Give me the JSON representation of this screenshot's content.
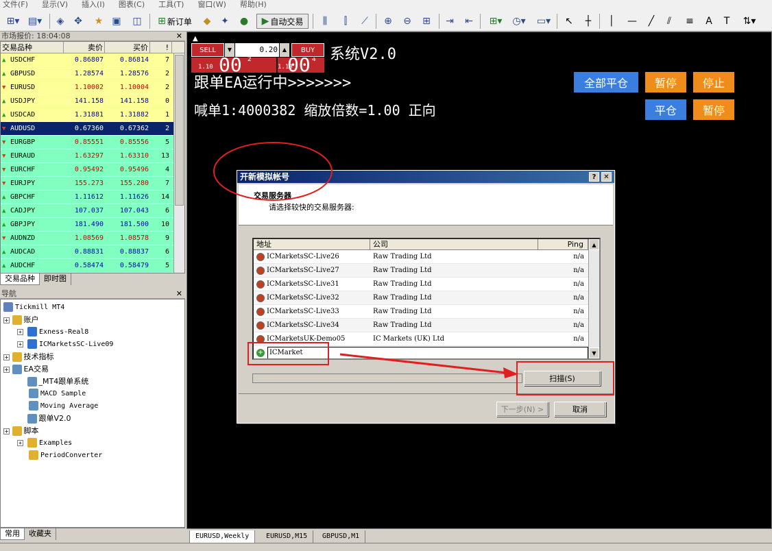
{
  "menu": [
    "文件(F)",
    "显示(V)",
    "插入(I)",
    "图表(C)",
    "工具(T)",
    "窗口(W)",
    "帮助(H)"
  ],
  "toolbar": {
    "new_order": "新订单",
    "auto_trade": "自动交易"
  },
  "market_watch": {
    "title": "市场报价: 18:04:08",
    "headers": [
      "交易品种",
      "卖价",
      "买价",
      "!"
    ],
    "rows": [
      {
        "symbol": "USDCHF",
        "bid": "0.86807",
        "ask": "0.86814",
        "spread": "7",
        "dir": "up",
        "bg": "#ffff99"
      },
      {
        "symbol": "GBPUSD",
        "bid": "1.28574",
        "ask": "1.28576",
        "spread": "2",
        "dir": "up",
        "bg": "#ffff99"
      },
      {
        "symbol": "EURUSD",
        "bid": "1.10002",
        "ask": "1.10004",
        "spread": "2",
        "dir": "down",
        "bg": "#ffff99"
      },
      {
        "symbol": "USDJPY",
        "bid": "141.158",
        "ask": "141.158",
        "spread": "0",
        "dir": "up",
        "bg": "#ffff99"
      },
      {
        "symbol": "USDCAD",
        "bid": "1.31881",
        "ask": "1.31882",
        "spread": "1",
        "dir": "up",
        "bg": "#ffff99"
      },
      {
        "symbol": "AUDUSD",
        "bid": "0.67360",
        "ask": "0.67362",
        "spread": "2",
        "dir": "down",
        "bg": "#0a246a"
      },
      {
        "symbol": "EURGBP",
        "bid": "0.85551",
        "ask": "0.85556",
        "spread": "5",
        "dir": "down",
        "bg": "#80ffc0"
      },
      {
        "symbol": "EURAUD",
        "bid": "1.63297",
        "ask": "1.63310",
        "spread": "13",
        "dir": "down",
        "bg": "#80ffc0"
      },
      {
        "symbol": "EURCHF",
        "bid": "0.95492",
        "ask": "0.95496",
        "spread": "4",
        "dir": "down",
        "bg": "#80ffc0"
      },
      {
        "symbol": "EURJPY",
        "bid": "155.273",
        "ask": "155.280",
        "spread": "7",
        "dir": "down",
        "bg": "#80ffc0"
      },
      {
        "symbol": "GBPCHF",
        "bid": "1.11612",
        "ask": "1.11626",
        "spread": "14",
        "dir": "up",
        "bg": "#80ffc0"
      },
      {
        "symbol": "CADJPY",
        "bid": "107.037",
        "ask": "107.043",
        "spread": "6",
        "dir": "up",
        "bg": "#80ffc0"
      },
      {
        "symbol": "GBPJPY",
        "bid": "181.490",
        "ask": "181.500",
        "spread": "10",
        "dir": "up",
        "bg": "#80ffc0"
      },
      {
        "symbol": "AUDNZD",
        "bid": "1.08569",
        "ask": "1.08578",
        "spread": "9",
        "dir": "down",
        "bg": "#80ffc0"
      },
      {
        "symbol": "AUDCAD",
        "bid": "0.88831",
        "ask": "0.88837",
        "spread": "6",
        "dir": "up",
        "bg": "#80ffc0"
      },
      {
        "symbol": "AUDCHF",
        "bid": "0.58474",
        "ask": "0.58479",
        "spread": "5",
        "dir": "up",
        "bg": "#80ffc0"
      }
    ],
    "tabs": [
      "交易品种",
      "即时图"
    ]
  },
  "navigator": {
    "title": "导航",
    "items": [
      {
        "label": "Tickmill MT4",
        "level": 0,
        "cn": false,
        "plus": false,
        "icon": "#6080c0"
      },
      {
        "label": "账户",
        "level": 0,
        "cn": true,
        "plus": true,
        "icon": "#e0b030"
      },
      {
        "label": "Exness-Real8",
        "level": 1,
        "cn": false,
        "plus": true,
        "icon": "#3070d0"
      },
      {
        "label": "ICMarketsSC-Live09",
        "level": 1,
        "cn": false,
        "plus": true,
        "icon": "#3070d0"
      },
      {
        "label": "技术指标",
        "level": 0,
        "cn": true,
        "plus": true,
        "icon": "#e0b030"
      },
      {
        "label": "EA交易",
        "level": 0,
        "cn": true,
        "plus": true,
        "icon": "#6090c0"
      },
      {
        "label": "_MT4跟单系统",
        "level": 1,
        "cn": true,
        "plus": false,
        "icon": "#6090c0"
      },
      {
        "label": "MACD Sample",
        "level": 1,
        "cn": false,
        "plus": false,
        "icon": "#6090c0"
      },
      {
        "label": "Moving Average",
        "level": 1,
        "cn": false,
        "plus": false,
        "icon": "#6090c0"
      },
      {
        "label": "跟单V2.0",
        "level": 1,
        "cn": true,
        "plus": false,
        "icon": "#6090c0"
      },
      {
        "label": "脚本",
        "level": 0,
        "cn": true,
        "plus": true,
        "icon": "#e0b030"
      },
      {
        "label": "Examples",
        "level": 1,
        "cn": false,
        "plus": true,
        "icon": "#e0b030"
      },
      {
        "label": "PeriodConverter",
        "level": 1,
        "cn": false,
        "plus": false,
        "icon": "#e0b030"
      }
    ],
    "tabs": [
      "常用",
      "收藏夹"
    ]
  },
  "chart": {
    "sell_label": "SELL",
    "buy_label": "BUY",
    "lot": "0.20",
    "sell_price_small": "1.10",
    "sell_price_big": "00",
    "sell_price_sup": "2",
    "buy_price_small": "1.10",
    "buy_price_big": "00",
    "buy_price_sup": "4",
    "system_title": "系统V2.0",
    "status_line": "跟单EA运行中>>>>>>>",
    "info_line": "喊单1:4000382 缩放倍数=1.00 正向",
    "btn_close_all": "全部平仓",
    "btn_pause1": "暂停",
    "btn_stop": "停止",
    "btn_close": "平仓",
    "btn_pause2": "暂停",
    "tabs": [
      "EURUSD,Weekly",
      "EURUSD,M15",
      "GBPUSD,M1"
    ]
  },
  "dialog": {
    "title": "开新模拟帐号",
    "heading": "交易服务器",
    "subheading": "请选择较快的交易服务器:",
    "col_address": "地址",
    "col_company": "公司",
    "col_ping": "Ping",
    "rows": [
      {
        "addr": "ICMarketsSC-Live26",
        "company": "Raw Trading Ltd",
        "ping": "n/a"
      },
      {
        "addr": "ICMarketsSC-Live27",
        "company": "Raw Trading Ltd",
        "ping": "n/a"
      },
      {
        "addr": "ICMarketsSC-Live31",
        "company": "Raw Trading Ltd",
        "ping": "n/a"
      },
      {
        "addr": "ICMarketsSC-Live32",
        "company": "Raw Trading Ltd",
        "ping": "n/a"
      },
      {
        "addr": "ICMarketsSC-Live33",
        "company": "Raw Trading Ltd",
        "ping": "n/a"
      },
      {
        "addr": "ICMarketsSC-Live34",
        "company": "Raw Trading Ltd",
        "ping": "n/a"
      },
      {
        "addr": "ICMarketsUK-Demo05",
        "company": "IC Markets (UK) Ltd",
        "ping": "n/a"
      }
    ],
    "input_value": "ICMarket",
    "scan_label": "扫描(S)",
    "next_label": "下一步(N) >",
    "cancel_label": "取消"
  }
}
